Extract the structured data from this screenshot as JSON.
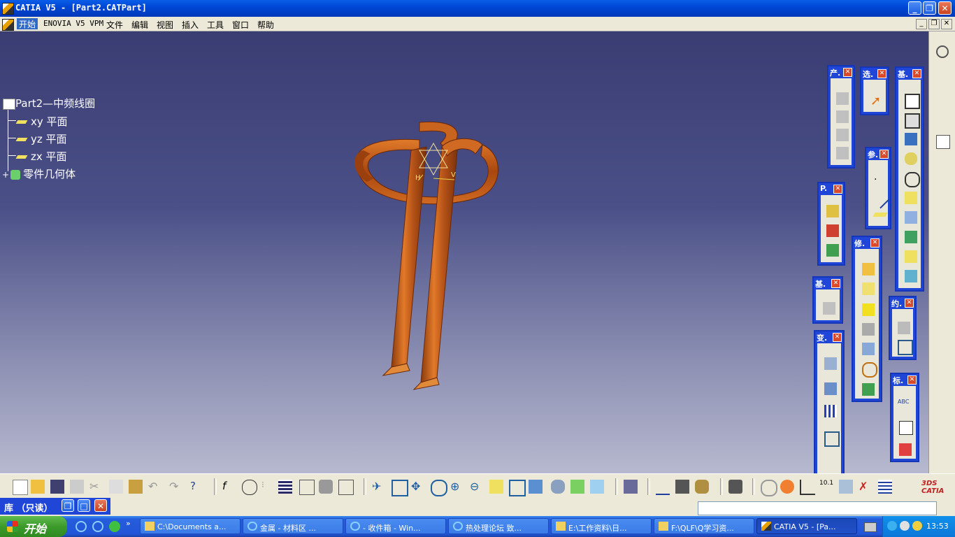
{
  "window": {
    "title": "CATIA V5 - [Part2.CATPart]",
    "controls": {
      "minimize": "_",
      "maximize": "❐",
      "close": "✕"
    }
  },
  "menu": {
    "items": [
      "开始",
      "ENOVIA V5 VPM",
      "文件",
      "编辑",
      "视图",
      "插入",
      "工具",
      "窗口",
      "帮助"
    ]
  },
  "tree": {
    "root": "Part2—中频线圈",
    "children": [
      "xy 平面",
      "yz 平面",
      "zx 平面",
      "零件几何体"
    ]
  },
  "axis_labels": {
    "h": "H",
    "v": "V"
  },
  "toolbars": [
    {
      "id": "product",
      "label": "产."
    },
    {
      "id": "select",
      "label": "选."
    },
    {
      "id": "base-features",
      "label": "基."
    },
    {
      "id": "reference",
      "label": "参."
    },
    {
      "id": "post",
      "label": "P."
    },
    {
      "id": "modify",
      "label": "修."
    },
    {
      "id": "base2",
      "label": "基."
    },
    {
      "id": "transform",
      "label": "变."
    },
    {
      "id": "constraint",
      "label": "约."
    },
    {
      "id": "annotation",
      "label": "标."
    }
  ],
  "text_icon": "ABC",
  "status": {
    "library_label": "库 （只读）",
    "command_input": ""
  },
  "taskbar": {
    "start_label": "开始",
    "tasks": [
      "C:\\Documents a...",
      "金属 - 材料区 ...",
      "- 收件箱 - Win...",
      "热处理论坛 致...",
      "E:\\工作资料\\日...",
      "F:\\QLF\\Q学习资...",
      "CATIA V5 - [Pa..."
    ],
    "clock": "13:53"
  },
  "colors": {
    "accent": "#2046d8",
    "copper": "#c8641e",
    "viewport_top": "#3a3d72",
    "viewport_bottom": "#b7b9cf"
  }
}
